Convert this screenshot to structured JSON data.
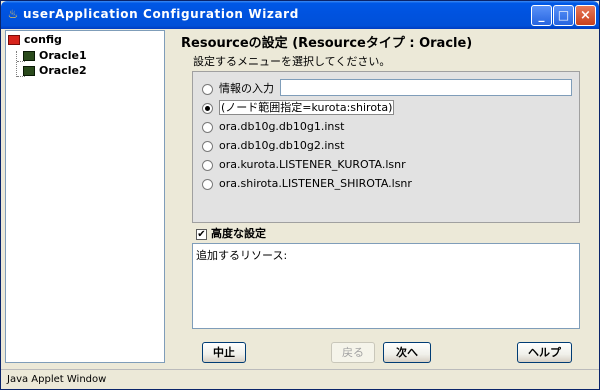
{
  "window": {
    "title": "userApplication Configuration Wizard",
    "buttons": {
      "minimize": "_",
      "maximize": "□",
      "close": "×"
    }
  },
  "tree": {
    "root": {
      "label": "config",
      "icon": "config-folder-icon"
    },
    "children": [
      {
        "label": "Oracle1",
        "icon": "resource-icon"
      },
      {
        "label": "Oracle2",
        "icon": "resource-icon"
      }
    ]
  },
  "main": {
    "title": "Resourceの設定 (Resourceタイプ : Oracle)",
    "subtitle": "設定するメニューを選択してください。",
    "options": [
      {
        "label": "情報の入力",
        "selected": false,
        "has_input": true
      },
      {
        "label": "(ノード範囲指定=kurota:shirota)",
        "selected": true
      },
      {
        "label": "ora.db10g.db10g1.inst",
        "selected": false
      },
      {
        "label": "ora.db10g.db10g2.inst",
        "selected": false
      },
      {
        "label": "ora.kurota.LISTENER_KUROTA.lsnr",
        "selected": false
      },
      {
        "label": "ora.shirota.LISTENER_SHIROTA.lsnr",
        "selected": false
      }
    ],
    "info_input": {
      "value": "",
      "placeholder": ""
    },
    "advanced": {
      "label": "高度な設定",
      "checked": true
    },
    "added_resources_text": "追加するリソース:"
  },
  "buttons": {
    "cancel": "中止",
    "back": "戻る",
    "next": "次へ",
    "help": "ヘルプ"
  },
  "status_bar": {
    "text": "Java Applet Window"
  }
}
